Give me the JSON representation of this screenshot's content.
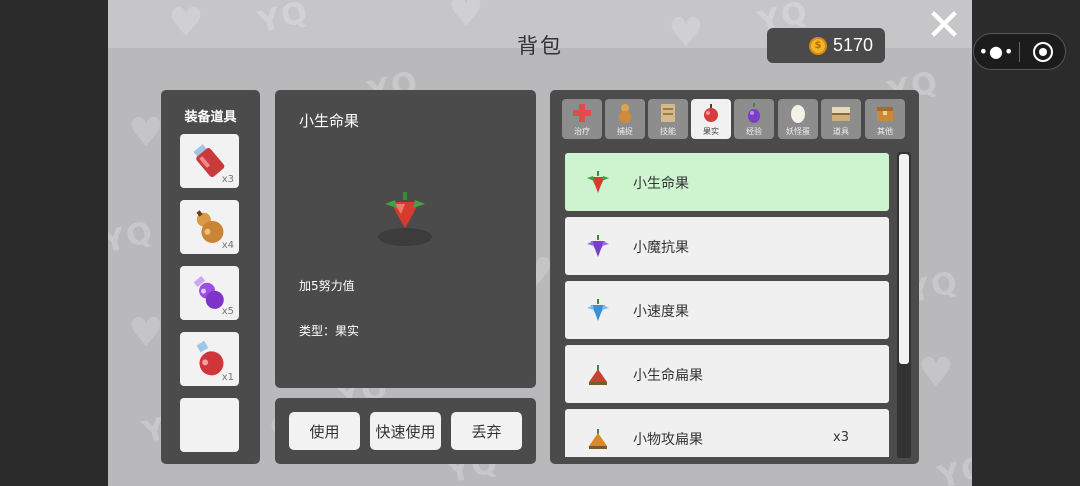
{
  "title": "背包",
  "coins": {
    "value": "5170",
    "icon": "gold-coin-icon"
  },
  "close": {
    "icon": "close-x-icon"
  },
  "mini_capsule": {
    "more": "•●•",
    "icon": "target-icon"
  },
  "watermark": "YQ",
  "equip": {
    "title": "装备道具",
    "slots": [
      {
        "icon": "red-potion-icon",
        "qty": "x3"
      },
      {
        "icon": "gourd-icon",
        "qty": "x4"
      },
      {
        "icon": "purple-potion-icon",
        "qty": "x5"
      },
      {
        "icon": "red-flask-icon",
        "qty": "x1"
      },
      {
        "icon": "",
        "qty": ""
      }
    ]
  },
  "detail": {
    "name": "小生命果",
    "icon": "red-berry-icon",
    "desc": "加5努力值",
    "type": "类型：果实"
  },
  "actions": {
    "use": "使用",
    "quick_use": "快速使用",
    "discard": "丢弃"
  },
  "tabs": [
    {
      "label": "治疗",
      "icon": "red-cross-icon",
      "active": false
    },
    {
      "label": "捕捉",
      "icon": "gourd-icon",
      "active": false
    },
    {
      "label": "技能",
      "icon": "scroll-icon",
      "active": false
    },
    {
      "label": "果实",
      "icon": "apple-icon",
      "active": true
    },
    {
      "label": "经验",
      "icon": "grape-icon",
      "active": false
    },
    {
      "label": "妖怪蛋",
      "icon": "egg-icon",
      "active": false
    },
    {
      "label": "道具",
      "icon": "chest-open-icon",
      "active": false
    },
    {
      "label": "其他",
      "icon": "box-icon",
      "active": false
    }
  ],
  "items": [
    {
      "name": "小生命果",
      "qty": "",
      "icon": "red-berry-icon",
      "color": "#d83b2e",
      "selected": true
    },
    {
      "name": "小魔抗果",
      "qty": "",
      "icon": "purple-berry-icon",
      "color": "#7b3ec7",
      "selected": false
    },
    {
      "name": "小速度果",
      "qty": "",
      "icon": "blue-berry-icon",
      "color": "#3c8fd6",
      "selected": false
    },
    {
      "name": "小生命扁果",
      "qty": "",
      "icon": "red-flat-berry-icon",
      "color": "#c7432f",
      "selected": false
    },
    {
      "name": "小物攻扁果",
      "qty": "x3",
      "icon": "orange-flat-berry-icon",
      "color": "#d8892a",
      "selected": false
    }
  ]
}
